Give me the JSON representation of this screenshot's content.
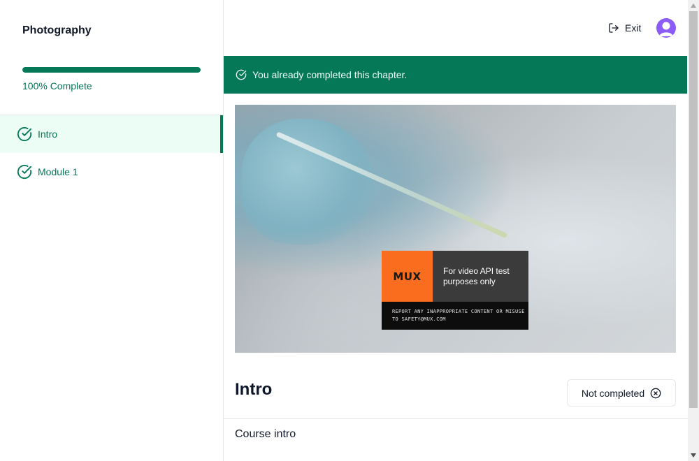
{
  "sidebar": {
    "course_title": "Photography",
    "progress_percent": 100,
    "progress_text": "100% Complete",
    "chapters": [
      {
        "label": "Intro",
        "active": true,
        "completed": true
      },
      {
        "label": "Module 1",
        "active": false,
        "completed": true
      }
    ]
  },
  "topbar": {
    "exit_label": "Exit",
    "exit_icon": "log-out-icon",
    "avatar_icon": "user-avatar"
  },
  "banner": {
    "text": "You already completed this chapter.",
    "icon": "check-circle-icon",
    "color": "#047857"
  },
  "video": {
    "mux_logo": "MUX",
    "mux_message": "For video API test purposes only",
    "mux_notice": "REPORT ANY INAPPROPRIATE CONTENT OR MISUSE TO SAFETY@MUX.COM"
  },
  "chapter": {
    "title": "Intro",
    "status_button_label": "Not completed",
    "status_button_icon": "x-circle-icon",
    "description": "Course intro"
  },
  "colors": {
    "accent": "#047857",
    "accent_light": "#ecfdf5",
    "avatar": "#8b5cf6",
    "mux_orange": "#fa6d1e"
  }
}
